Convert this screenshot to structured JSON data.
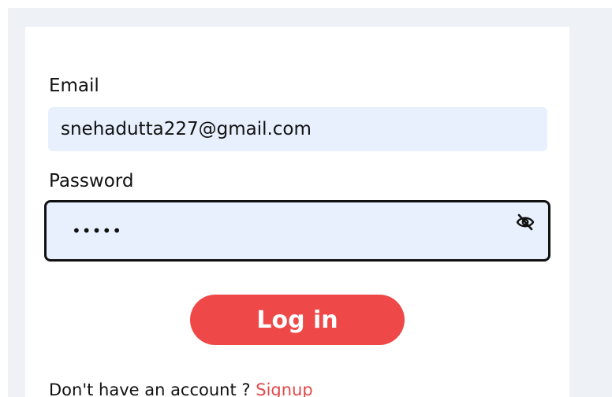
{
  "form": {
    "email_label": "Email",
    "email_value": "snehadutta227@gmail.com",
    "password_label": "Password",
    "password_value": "•••••",
    "password_toggle_icon": "eye-slash-icon",
    "login_label": "Log in",
    "signup_prompt": "Don't have an account ?",
    "signup_link": "Signup"
  },
  "colors": {
    "background": "#eef2f7",
    "input_fill": "#e8f0fe",
    "accent": "#ef4848",
    "link": "#e24a4a"
  }
}
